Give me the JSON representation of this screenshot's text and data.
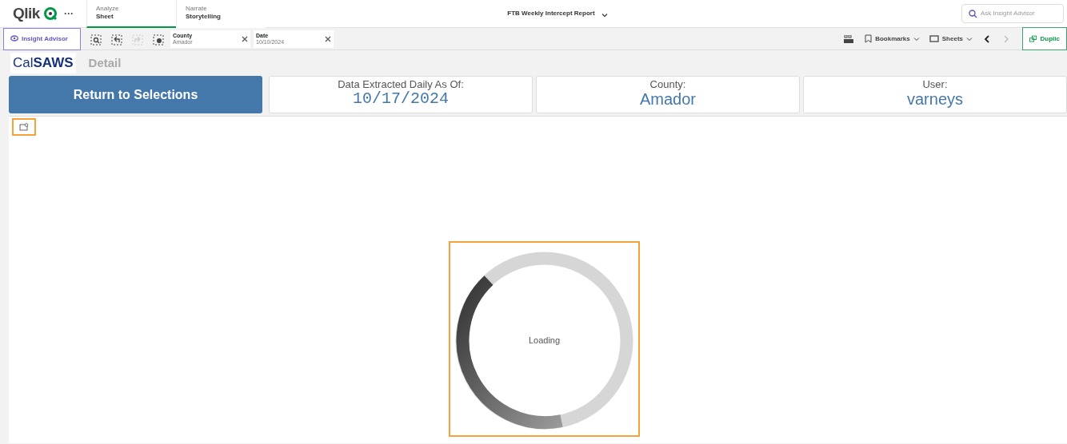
{
  "app": {
    "logo": "Qlik",
    "more": "···"
  },
  "tabs": [
    {
      "caption": "Analyze",
      "label": "Sheet",
      "selected": true
    },
    {
      "caption": "Narrate",
      "label": "Storytelling",
      "selected": false
    }
  ],
  "report_title": "FTB Weekly Intercept Report",
  "search": {
    "placeholder": "Ask Insight Advisor"
  },
  "toolbar": {
    "insight_advisor": "Insight Advisor",
    "tools": [
      {
        "kind": "smart-search",
        "disabled": false
      },
      {
        "kind": "back",
        "disabled": false
      },
      {
        "kind": "forward",
        "disabled": true
      },
      {
        "kind": "clear",
        "disabled": false
      }
    ],
    "selections": [
      {
        "field": "County",
        "value": "Amador"
      },
      {
        "field": "Date",
        "value": "10/10/2024"
      }
    ],
    "bookmarks": "Bookmarks",
    "sheets": "Sheets",
    "duplicate": "Duplic"
  },
  "brand": "Cal**SAWS**",
  "sheet_title": "Detail",
  "return_button": "Return to Selections",
  "kpis": [
    {
      "label": "Data Extracted Daily As Of:",
      "value": "10/17/2024"
    },
    {
      "label": "County:",
      "value": "Amador"
    },
    {
      "label": "User:",
      "value": "varneys"
    }
  ],
  "loading": "Loading"
}
